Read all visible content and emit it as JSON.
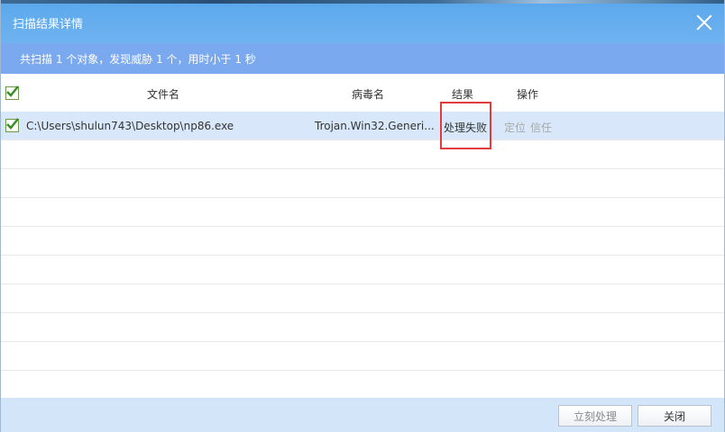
{
  "window": {
    "title": "扫描结果详情"
  },
  "summary": {
    "text": "共扫描 1 个对象，发现威胁 1 个，用时小于 1 秒"
  },
  "columns": {
    "file": "文件名",
    "virus": "病毒名",
    "result": "结果",
    "action": "操作"
  },
  "rows": [
    {
      "checked": true,
      "file": "C:\\Users\\shulun743\\Desktop\\np86.exe",
      "virus": "Trojan.Win32.Generi...",
      "result": "处理失败",
      "actions": [
        "定位",
        "信任"
      ]
    }
  ],
  "buttons": {
    "process_now": "立刻处理",
    "close": "关闭"
  },
  "colors": {
    "header_blue": "#5aa7ec",
    "summary_blue": "#7aa9ef",
    "highlight_red": "#e23b3b",
    "row_selected": "#d8e8fa"
  }
}
